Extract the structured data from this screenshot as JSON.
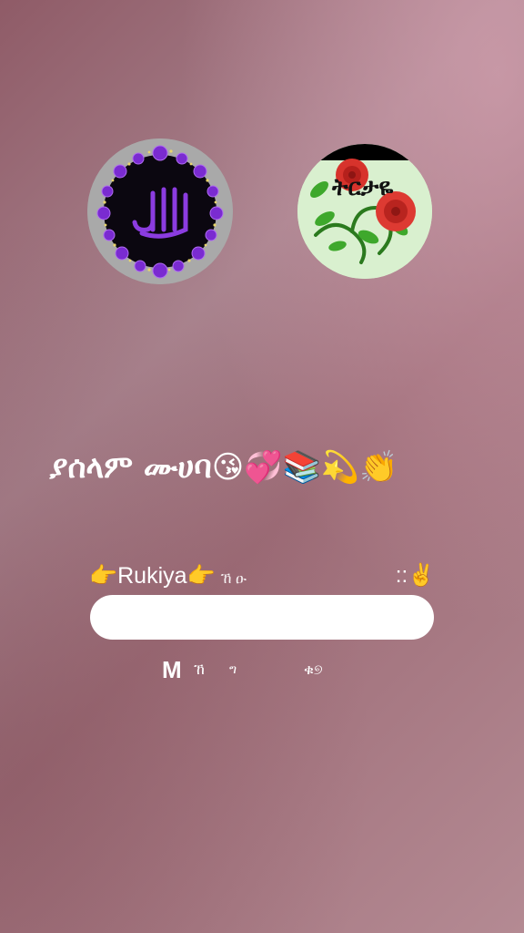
{
  "avatars": {
    "left": {
      "icon": "allah-calligraphy-purple-roses-icon"
    },
    "right": {
      "icon": "red-roses-icon",
      "label": "ትርታዬ"
    }
  },
  "greeting": {
    "text": "ያሰላም ሙሀባ",
    "emojis": "😘💞📚💫👏"
  },
  "name_row": {
    "left_text": "👉Rukiya👉",
    "left_faint": "ኸ  ዑ",
    "right_text": "::✌️"
  },
  "comment_input": {
    "value": "",
    "placeholder": ""
  },
  "caption": {
    "m": "M",
    "f1": "ኸ",
    "f2": "ግ",
    "f3": "ቁ୭"
  }
}
